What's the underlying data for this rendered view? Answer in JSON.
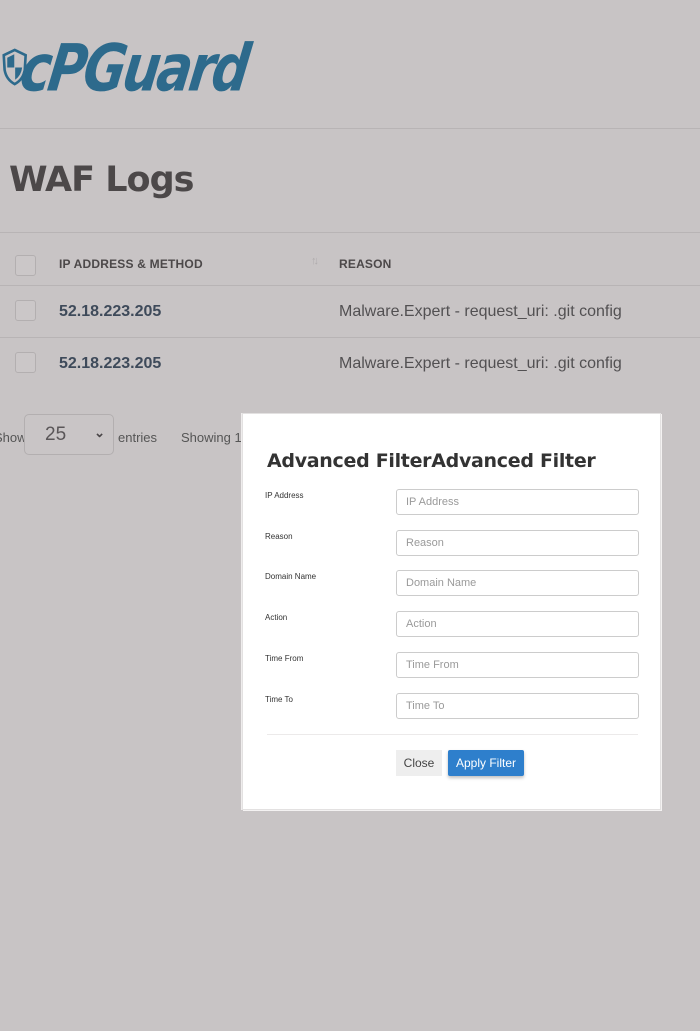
{
  "brand": {
    "logo_text": "cPGuard",
    "logo_color": "#2d6a8c"
  },
  "page": {
    "title": "WAF Logs"
  },
  "table": {
    "columns": [
      {
        "label": "IP ADDRESS & METHOD",
        "sortable": true
      },
      {
        "label": "REASON"
      }
    ],
    "sort_icon": "sort-arrows-icon",
    "rows": [
      {
        "ip": "52.18.223.205",
        "reason": "Malware.Expert - request_uri: .git config"
      },
      {
        "ip": "52.18.223.205",
        "reason": "Malware.Expert - request_uri: .git config"
      }
    ]
  },
  "pagination": {
    "show_label": "Show",
    "page_length": "25",
    "entries_label": "entries",
    "showing_text": "Showing 1"
  },
  "modal": {
    "title": "Advanced FilterAdvanced Filter",
    "fields": [
      {
        "label": "IP Address",
        "placeholder": "IP Address",
        "value": ""
      },
      {
        "label": "Reason",
        "placeholder": "Reason",
        "value": ""
      },
      {
        "label": "Domain Name",
        "placeholder": "Domain Name",
        "value": ""
      },
      {
        "label": "Action",
        "placeholder": "Action",
        "value": ""
      },
      {
        "label": "Time From",
        "placeholder": "Time From",
        "value": ""
      },
      {
        "label": "Time To",
        "placeholder": "Time To",
        "value": ""
      }
    ],
    "close_label": "Close",
    "apply_label": "Apply Filter",
    "apply_color": "#2e7fcc"
  }
}
